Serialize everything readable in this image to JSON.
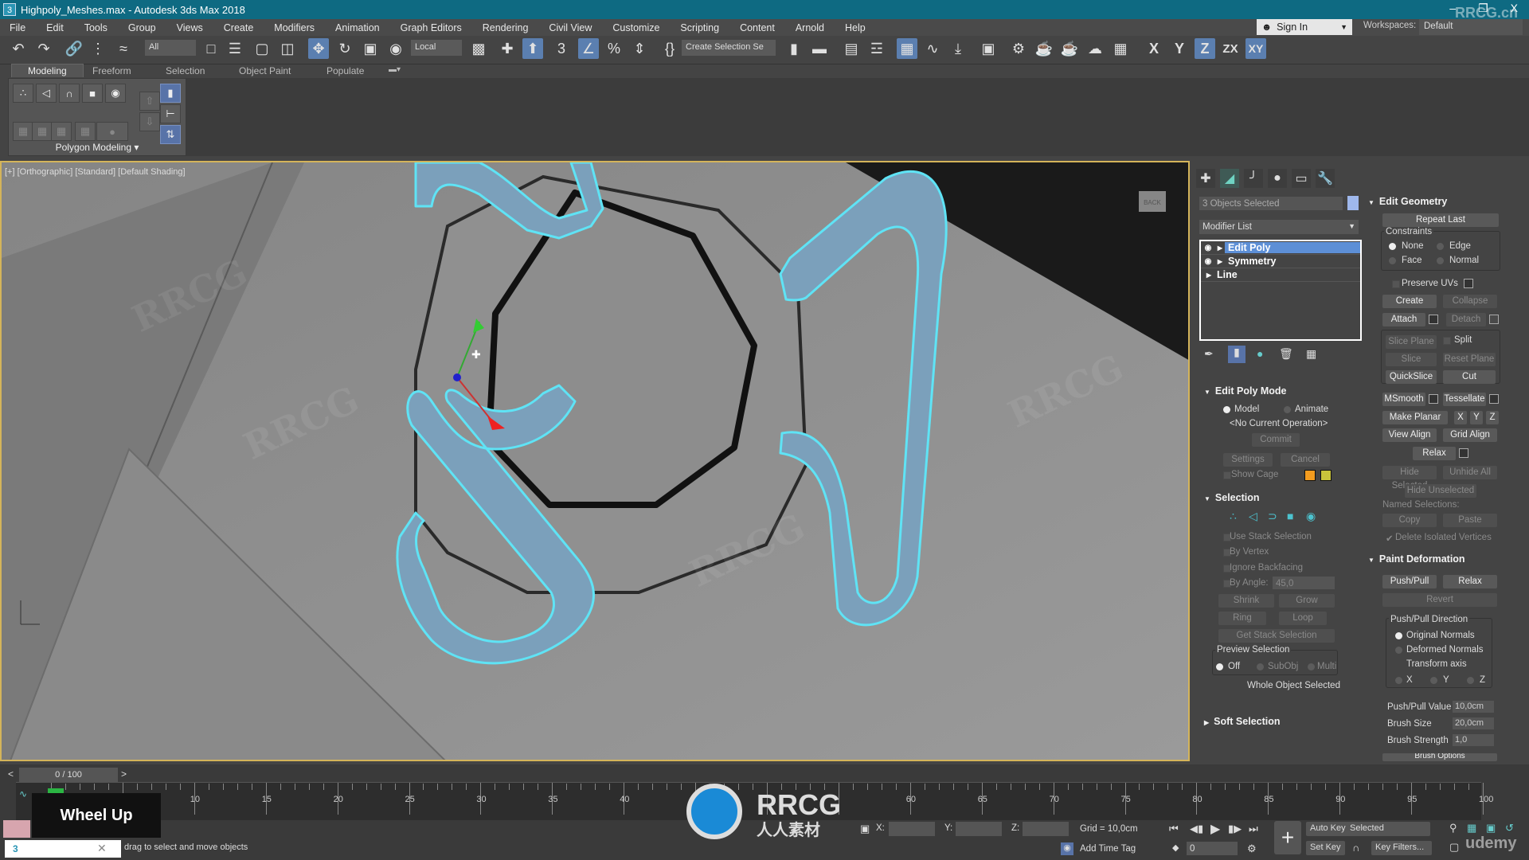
{
  "window": {
    "title": "Highpoly_Meshes.max - Autodesk 3ds Max 2018",
    "app_icon": "3",
    "watermark": "RRCG.cn",
    "minimize": "–",
    "restore": "❐",
    "close": "X"
  },
  "menu": [
    "File",
    "Edit",
    "Tools",
    "Group",
    "Views",
    "Create",
    "Modifiers",
    "Animation",
    "Graph Editors",
    "Rendering",
    "Civil View",
    "Customize",
    "Scripting",
    "Content",
    "Arnold",
    "Help"
  ],
  "account": {
    "sign_in": "Sign In",
    "workspaces_label": "Workspaces:",
    "workspace": "Default"
  },
  "toolbar": {
    "selection_filter": "All",
    "reference_coord": "Local",
    "named_selection": "Create Selection Se",
    "axis_buttons": [
      "X",
      "Y",
      "Z",
      "ZX",
      "XY"
    ],
    "active_axis": "Z"
  },
  "ribbon": {
    "tabs": [
      "Modeling",
      "Freeform",
      "Selection",
      "Object Paint",
      "Populate"
    ],
    "active_tab": "Modeling",
    "panel_label": "Polygon Modeling"
  },
  "viewport": {
    "label": "[+] [Orthographic] [Standard] [Default Shading]",
    "viewcube": "BACK",
    "selection_outline_color": "#5fe3f5",
    "border_color": "#d4b45a"
  },
  "command_panel": {
    "tabs": [
      "create",
      "modify",
      "hierarchy",
      "motion",
      "display",
      "utilities"
    ],
    "active_tab": "modify",
    "object_name": "3 Objects Selected",
    "object_color": "#9fb8ec",
    "modifier_list": "Modifier List",
    "stack": [
      {
        "name": "Edit Poly",
        "eye": true,
        "selected": true
      },
      {
        "name": "Symmetry",
        "eye": true,
        "selected": false
      },
      {
        "name": "Line",
        "eye": false,
        "selected": false
      }
    ],
    "edit_poly_mode": {
      "title": "Edit Poly Mode",
      "model": "Model",
      "animate": "Animate",
      "operation": "<No Current Operation>",
      "commit": "Commit",
      "settings": "Settings",
      "cancel": "Cancel",
      "show_cage": "Show Cage",
      "cage_colors": [
        "#f39c1f",
        "#c9c43b"
      ]
    },
    "selection": {
      "title": "Selection",
      "use_stack": "Use Stack Selection",
      "by_vertex": "By Vertex",
      "ignore_backfacing": "Ignore Backfacing",
      "by_angle": "By Angle:",
      "angle_value": "45,0",
      "shrink": "Shrink",
      "grow": "Grow",
      "ring": "Ring",
      "loop": "Loop",
      "get_stack": "Get Stack Selection",
      "preview_title": "Preview Selection",
      "preview_options": [
        "Off",
        "SubObj",
        "Multi"
      ],
      "status": "Whole Object Selected"
    },
    "soft_selection": {
      "title": "Soft Selection"
    }
  },
  "edit_geometry": {
    "title": "Edit Geometry",
    "repeat_last": "Repeat Last",
    "constraints": "Constraints",
    "constraint_options": [
      "None",
      "Edge",
      "Face",
      "Normal"
    ],
    "preserve_uvs": "Preserve UVs",
    "create": "Create",
    "collapse": "Collapse",
    "attach": "Attach",
    "detach": "Detach",
    "slice_plane": "Slice Plane",
    "split": "Split",
    "slice": "Slice",
    "reset_plane": "Reset Plane",
    "quickslice": "QuickSlice",
    "cut": "Cut",
    "msmooth": "MSmooth",
    "tessellate": "Tessellate",
    "make_planar": "Make Planar",
    "x": "X",
    "y": "Y",
    "z": "Z",
    "view_align": "View Align",
    "grid_align": "Grid Align",
    "relax": "Relax",
    "hide_selected": "Hide Selected",
    "unhide_all": "Unhide All",
    "hide_unselected": "Hide Unselected",
    "named_selections": "Named Selections:",
    "copy": "Copy",
    "paste": "Paste",
    "delete_isolated": "Delete Isolated Vertices"
  },
  "paint_deformation": {
    "title": "Paint Deformation",
    "push_pull": "Push/Pull",
    "relax": "Relax",
    "revert": "Revert",
    "direction_title": "Push/Pull Direction",
    "original_normals": "Original Normals",
    "deformed_normals": "Deformed Normals",
    "transform_axis": "Transform axis",
    "axes": [
      "X",
      "Y",
      "Z"
    ],
    "push_pull_value_label": "Push/Pull Value",
    "push_pull_value": "10,0cm",
    "brush_size_label": "Brush Size",
    "brush_size": "20,0cm",
    "brush_strength_label": "Brush Strength",
    "brush_strength": "1,0",
    "brush_options": "Brush Options"
  },
  "timeline": {
    "frame": "0 / 100",
    "prev": "<",
    "next": ">",
    "ticks": [
      "10",
      "15",
      "20",
      "25",
      "30",
      "35",
      "40",
      "60",
      "65",
      "70",
      "75",
      "80",
      "85",
      "90",
      "95",
      "100"
    ],
    "overlay": "Wheel Up"
  },
  "statusbar": {
    "prompt": "drag to select and move objects",
    "x_label": "X:",
    "y_label": "Y:",
    "z_label": "Z:",
    "grid": "Grid = 10,0cm",
    "add_time_tag": "Add Time Tag",
    "current_frame": "0",
    "auto_key": "Auto Key",
    "set_key": "Set Key",
    "key_mode": "Selected",
    "key_filters": "Key Filters...",
    "watermark_logo": "RRCG",
    "watermark_sub": "人人素材",
    "udemy": "udemy"
  }
}
